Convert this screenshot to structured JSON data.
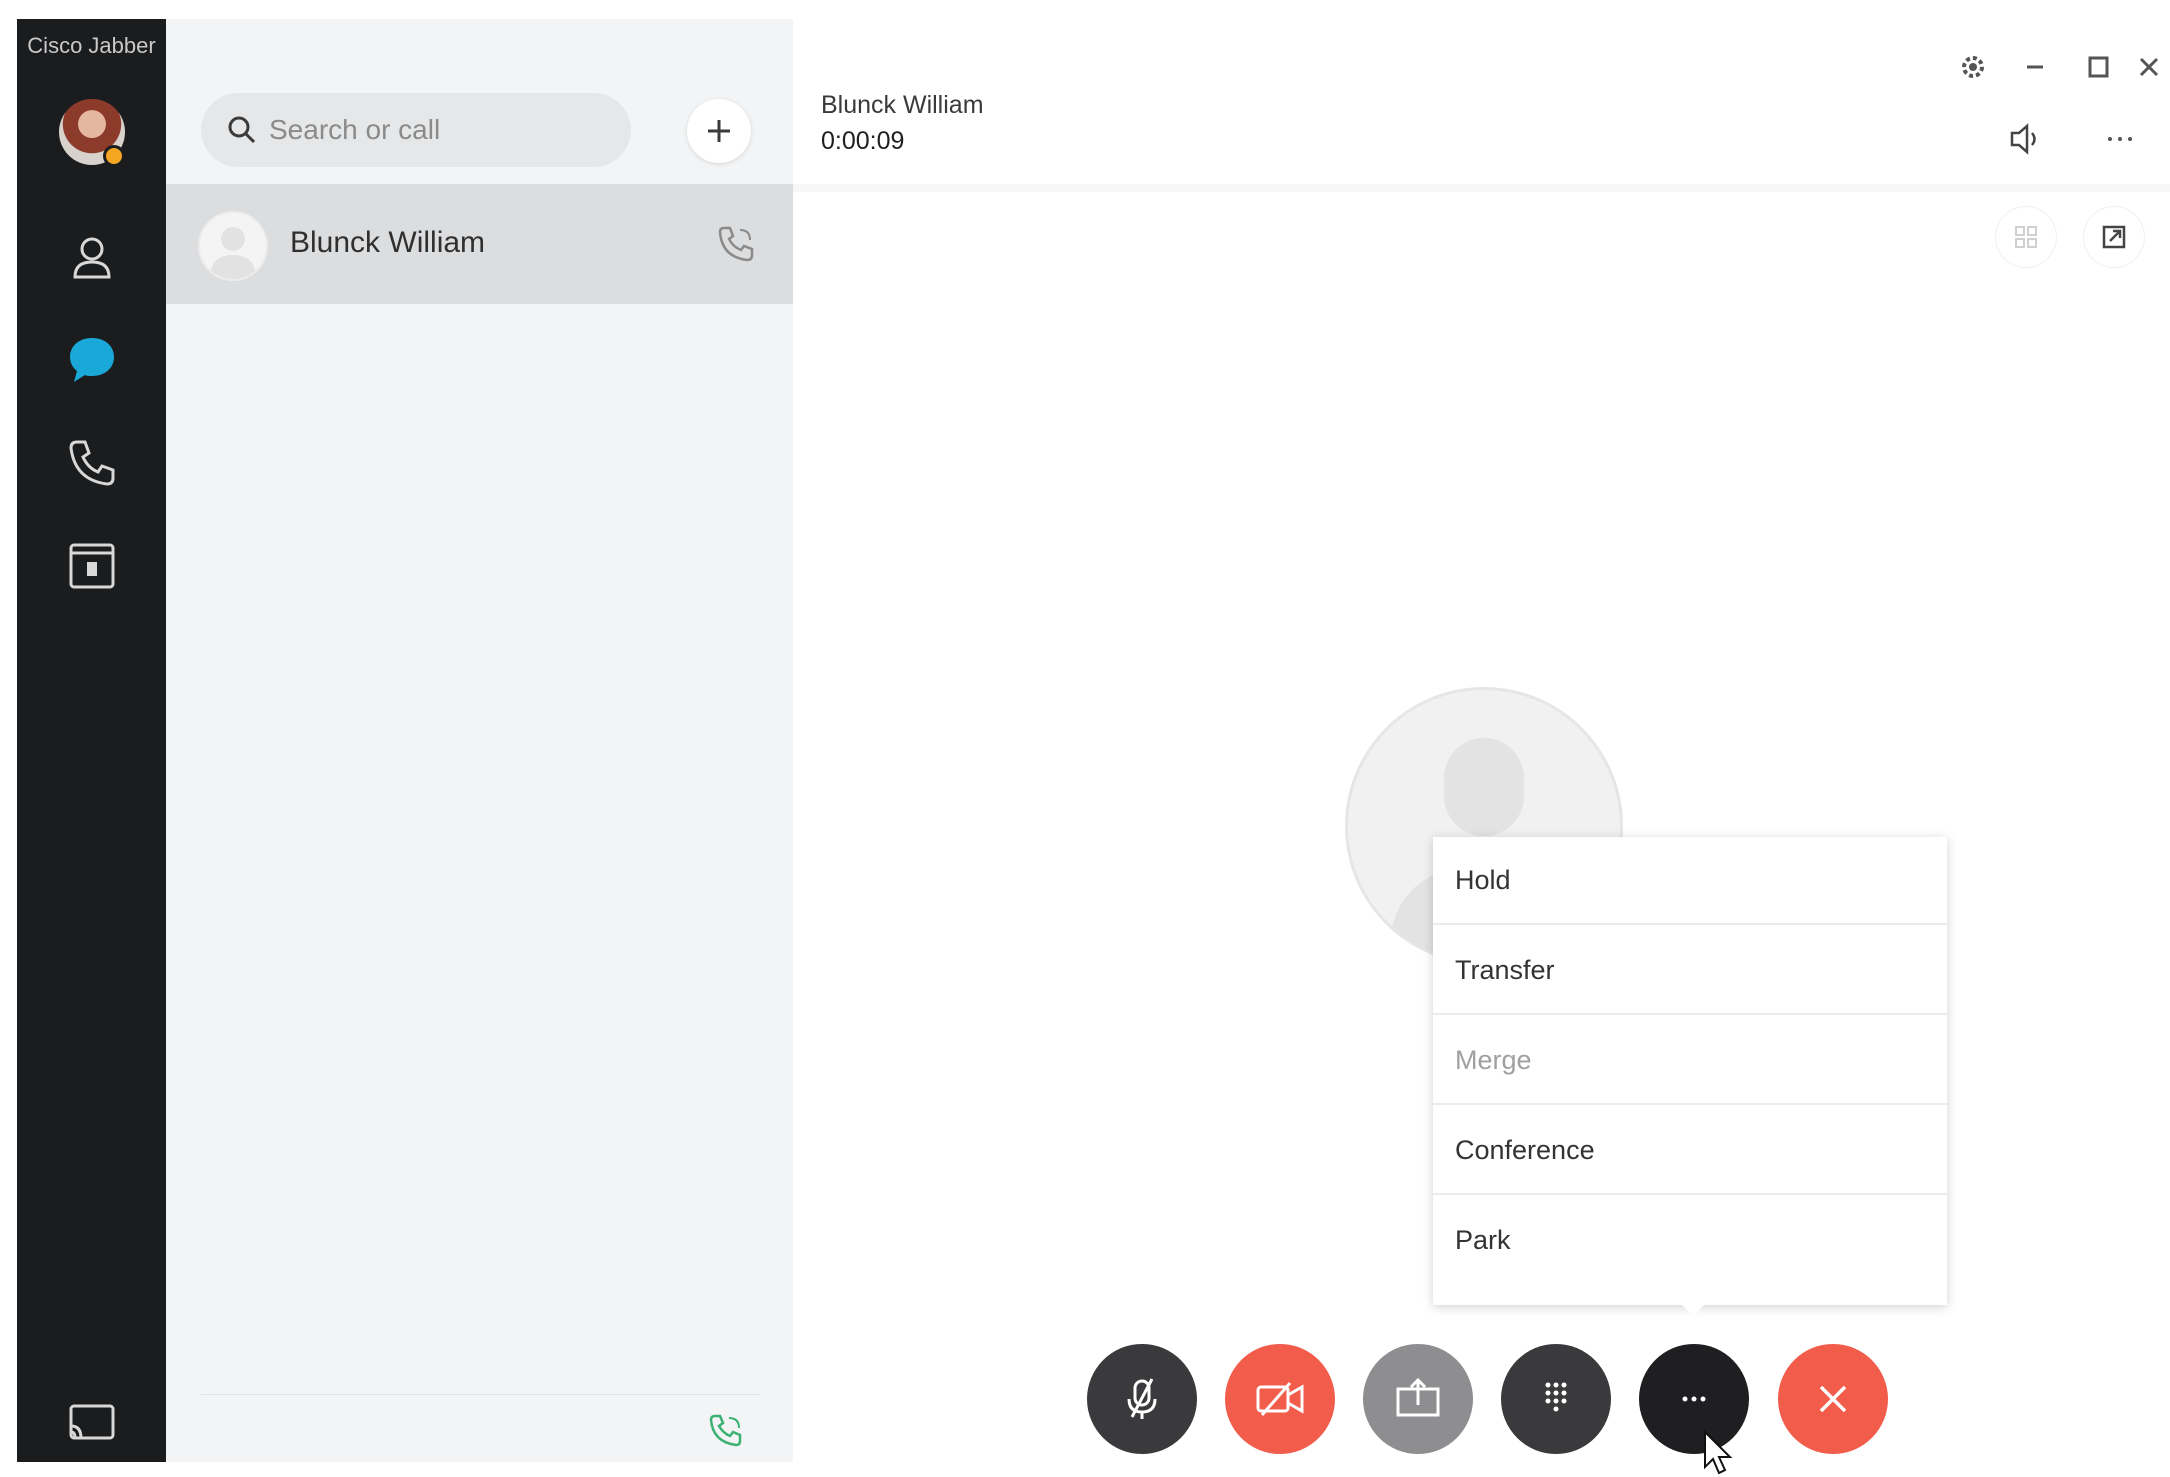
{
  "app": {
    "title": "Cisco Jabber",
    "presence_color": "#f5a623"
  },
  "rail": {
    "items": [
      {
        "name": "contacts",
        "icon": "contacts-icon"
      },
      {
        "name": "chats",
        "icon": "chat-bubble-icon",
        "active": true,
        "color": "#1aa8d8"
      },
      {
        "name": "calls",
        "icon": "phone-icon"
      },
      {
        "name": "meetings",
        "icon": "calendar-icon"
      }
    ],
    "bottom_icon": "cast-icon"
  },
  "search": {
    "placeholder": "Search or call",
    "icon": "search-icon"
  },
  "add_button_icon": "plus-icon",
  "active_call": {
    "contact_name": "Blunck William",
    "call_icon": "phone-icon",
    "footer_call_color": "#3bb273"
  },
  "call_header": {
    "name": "Blunck William",
    "timer": "0:00:09",
    "speaker_icon": "speaker-icon",
    "more_icon": "more-horizontal-icon"
  },
  "window_controls": [
    "gear-icon",
    "minimize-icon",
    "maximize-icon",
    "close-icon"
  ],
  "call_menu": {
    "items": [
      {
        "label": "Hold",
        "enabled": true
      },
      {
        "label": "Transfer",
        "enabled": true
      },
      {
        "label": "Merge",
        "enabled": false
      },
      {
        "label": "Conference",
        "enabled": true
      },
      {
        "label": "Park",
        "enabled": true
      }
    ]
  },
  "controls": [
    {
      "name": "mute",
      "icon": "microphone-icon",
      "color": "#3a3a3c"
    },
    {
      "name": "video",
      "icon": "video-off-icon",
      "color": "#f25c4a"
    },
    {
      "name": "share",
      "icon": "share-screen-icon",
      "color": "#8e8e90"
    },
    {
      "name": "keypad",
      "icon": "keypad-icon",
      "color": "#3a3a3c"
    },
    {
      "name": "more",
      "icon": "more-horizontal-icon",
      "color": "#1f1f21"
    },
    {
      "name": "end-call",
      "icon": "close-icon",
      "color": "#f25c4a"
    }
  ]
}
